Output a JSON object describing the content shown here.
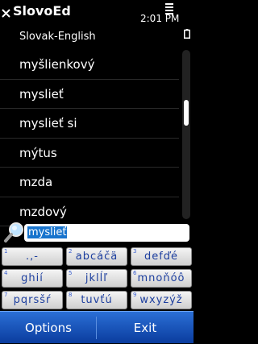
{
  "title_bar": {
    "app_title": "SlovoEd",
    "subtitle": "Slovak-English",
    "time": "2:01 PM",
    "close_icon": "close-icon",
    "signal_icon": "signal-icon",
    "battery_icon": "battery-icon"
  },
  "word_list": [
    {
      "word": "myšlienkový"
    },
    {
      "word": "myslieť"
    },
    {
      "word": "myslieť si"
    },
    {
      "word": "mýtus"
    },
    {
      "word": "mzda"
    },
    {
      "word": "mzdový"
    }
  ],
  "search": {
    "icon": "search-icon",
    "value": "myslieť"
  },
  "keypad": {
    "keys": [
      {
        "number": "1",
        "label": ".,-"
      },
      {
        "number": "2",
        "label": "abcáčä"
      },
      {
        "number": "3",
        "label": "defďé"
      },
      {
        "number": "4",
        "label": "ghií"
      },
      {
        "number": "5",
        "label": "jklĺľ"
      },
      {
        "number": "6",
        "label": "mnoňóô"
      },
      {
        "number": "7",
        "label": "pqrsšŕ"
      },
      {
        "number": "8",
        "label": "tuvťú"
      },
      {
        "number": "9",
        "label": "wxyzýž"
      }
    ]
  },
  "softkeys": {
    "left_label": "Options",
    "right_label": "Exit"
  },
  "colors": {
    "background": "#000000",
    "softkey_bar": "#1f5fc8",
    "selection": "#1874cd",
    "key_text": "#1d3f9f"
  }
}
